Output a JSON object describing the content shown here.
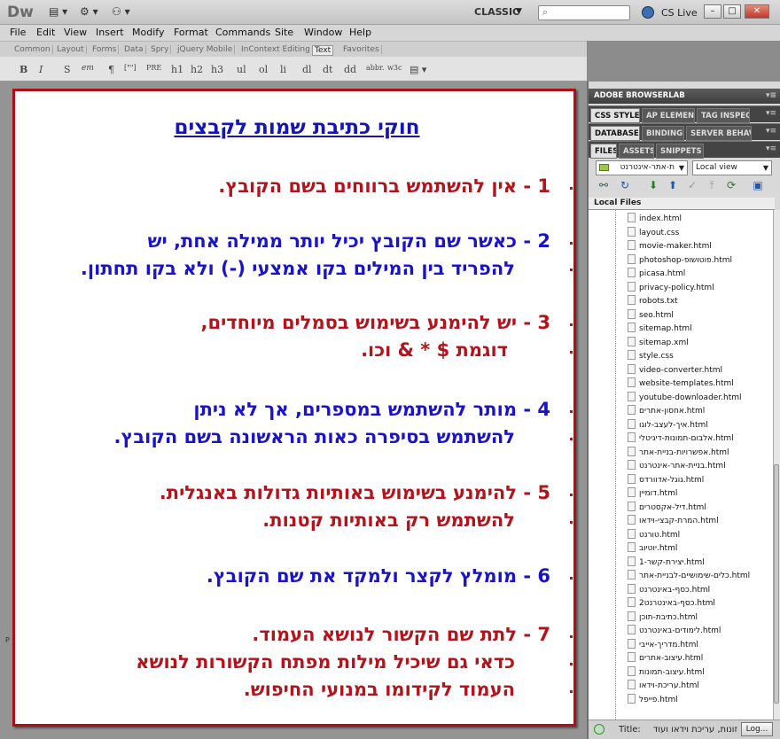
{
  "app": {
    "logo": "Dw",
    "workspace": "CLASSIC",
    "cs_live": "CS Live",
    "window_buttons": [
      "–",
      "□",
      "✕"
    ]
  },
  "menu": [
    "File",
    "Edit",
    "View",
    "Insert",
    "Modify",
    "Format",
    "Commands",
    "Site",
    "Window",
    "Help"
  ],
  "insert_tabs": [
    "Common",
    "Layout",
    "Forms",
    "Data",
    "Spry",
    "jQuery Mobile",
    "InContext Editing",
    "Text",
    "Favorites"
  ],
  "text_toolbar": [
    "B",
    "I",
    "S",
    "em",
    "¶",
    "[\"\"]",
    "PRE",
    "h1",
    "h2",
    "h3",
    "ul",
    "ol",
    "li",
    "dl",
    "dt",
    "dd",
    "abbr.",
    "w3c"
  ],
  "document": {
    "heading": "חוקי כתיבת שמות לקבצים",
    "rules": [
      {
        "lines": [
          "1 - אין להשתמש ברווחים בשם הקובץ."
        ]
      },
      {
        "lines": [
          "2 - כאשר שם הקובץ יכיל יותר ממילה אחת, יש",
          "להפריד בין המילים בקו אמצעי (-) ולא בקו תחתון."
        ]
      },
      {
        "lines": [
          "3 - יש להימנע בשימוש בסמלים מיוחדים,",
          "דוגמת $ * & וכו."
        ]
      },
      {
        "lines": [
          "4 - מותר להשתמש במספרים, אך לא ניתן",
          "להשתמש בסיפרה כאות הראשונה בשם הקובץ."
        ]
      },
      {
        "lines": [
          "5 - להימנע בשימוש באותיות גדולות באנגלית.",
          "להשתמש רק באותיות קטנות."
        ]
      },
      {
        "lines": [
          "6 - מומלץ לקצר ולמקד את שם הקובץ."
        ]
      },
      {
        "lines": [
          "7 - לתת שם הקשור לנושא העמוד.",
          "כדאי גם שיכיל מילות מפתח הקשורות לנושא",
          "העמוד לקידומו במנועי החיפוש."
        ]
      }
    ]
  },
  "panels": {
    "browserlab": "ADOBE BROWSERLAB",
    "tabs_row1": [
      "CSS STYLES",
      "AP ELEMENTS",
      "TAG INSPECTOR"
    ],
    "tabs_row2": [
      "DATABASES",
      "BINDINGS",
      "SERVER BEHAVIORS"
    ],
    "tabs_row3": [
      "FILES",
      "ASSETS",
      "SNIPPETS"
    ],
    "site_select": "ת-אתר-אינטרנט",
    "view_select": "Local view",
    "local_files": "Local Files",
    "files": [
      "index.html",
      "layout.css",
      "movie-maker.html",
      "photoshop-פוטושופ.html",
      "picasa.html",
      "privacy-policy.html",
      "robots.txt",
      "seo.html",
      "sitemap.html",
      "sitemap.xml",
      "style.css",
      "video-converter.html",
      "website-templates.html",
      "youtube-downloader.html",
      "אחסון-אתרים.html",
      "איך-לעצב-לוגו.html",
      "אלבום-תמונות-דיגיטלי.html",
      "אפשרויות-בניית-אתר.html",
      "בניית-אתר-אינטרנט.html",
      "גוגל-אדוורדס.html",
      "דומיין.html",
      "דיל-אקסטרים.html",
      "המרת-קבצי-וידאו.html",
      "טורנט.html",
      "יוטיוב.html",
      "יצירת-קשר-1.html",
      "כלים-שימושיים-לבניית-אתר.html",
      "כסף-באינטרנט.html",
      "כסף-באינטרנט2.html",
      "כתיבת-תוכן.html",
      "לימודים-באינטרנט.html",
      "מדריך-אייבי.html",
      "עיצוב-אתרים.html",
      "עיצוב-תמונות.html",
      "עריכת-וידאו.html",
      "פייפל.html"
    ],
    "status_label": "Title:",
    "status_value": "זונות, עריכת וידאו ועוד",
    "log_button": "Log..."
  }
}
